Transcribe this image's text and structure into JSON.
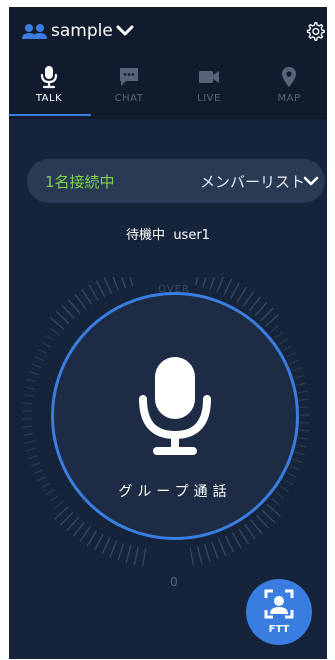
{
  "header": {
    "group_name": "sample",
    "icons": [
      "group-icon",
      "chevron-down-icon",
      "gear-icon"
    ]
  },
  "tabs": [
    {
      "label": "TALK",
      "icon": "microphone-icon",
      "active": true
    },
    {
      "label": "CHAT",
      "icon": "chat-icon",
      "active": false
    },
    {
      "label": "LIVE",
      "icon": "video-camera-icon",
      "active": false
    },
    {
      "label": "MAP",
      "icon": "map-pin-icon",
      "active": false
    }
  ],
  "member_bar": {
    "connected": "1名接続中",
    "member_list": "メンバーリスト"
  },
  "status": {
    "state": "待機中",
    "user": "user1"
  },
  "dial": {
    "top_label": "OVER",
    "bottom_label": "0"
  },
  "talk_button": {
    "label": "グループ通話"
  },
  "ftt_button": {
    "label": "FTT"
  },
  "colors": {
    "background": "#15243a",
    "header": "#101c2e",
    "accent": "#3a7de0",
    "connected_green": "#7cd44a",
    "inactive_tab": "#56647a"
  }
}
